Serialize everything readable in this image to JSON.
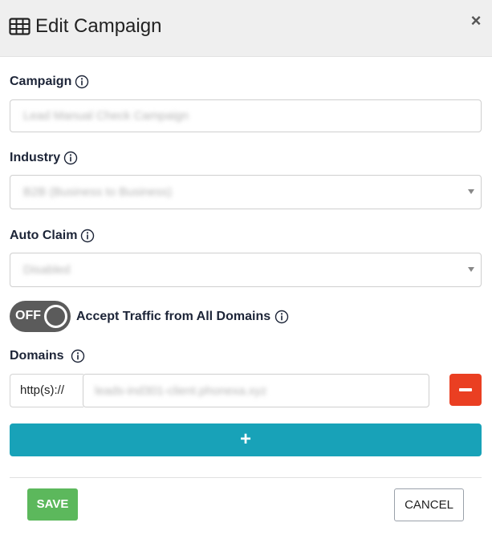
{
  "dialog": {
    "title": "Edit Campaign",
    "close_label": "×"
  },
  "fields": {
    "campaign": {
      "label": "Campaign",
      "value": "Lead Manual Check Campaign"
    },
    "industry": {
      "label": "Industry",
      "value": "B2B (Business to Business)"
    },
    "auto_claim": {
      "label": "Auto Claim",
      "value": "Disabled"
    }
  },
  "traffic_toggle": {
    "state": "OFF",
    "label": "Accept Traffic from All Domains"
  },
  "domains": {
    "label": "Domains",
    "prefix": "http(s)://",
    "items": [
      "leads-ind301-client.phonexa.xyz"
    ],
    "add_label": "+"
  },
  "footer": {
    "save_label": "SAVE",
    "cancel_label": "CANCEL"
  },
  "colors": {
    "add_button": "#18a2b8",
    "remove_button": "#ea3f22",
    "save_button": "#5cb85c",
    "toggle_off": "#5b5b5b"
  }
}
